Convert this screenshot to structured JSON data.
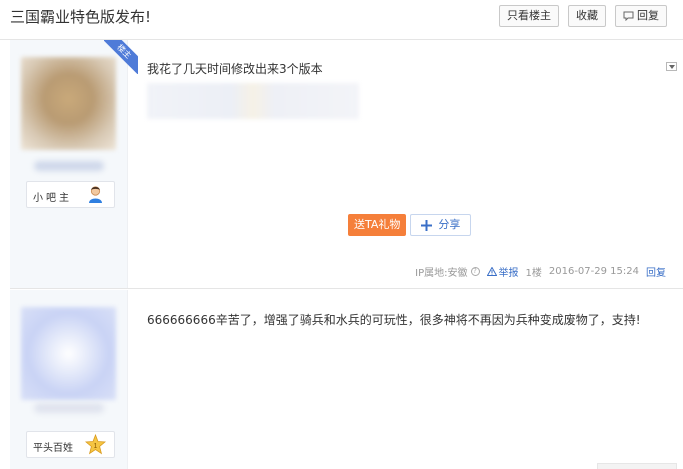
{
  "thread": {
    "title": "三国霸业特色版发布!",
    "buttons": {
      "only_op": "只看楼主",
      "favorite": "收藏",
      "reply": "回复"
    }
  },
  "posts": [
    {
      "corner_tag": "楼主",
      "author_badge": "小吧主",
      "badge_icon": "user-icon",
      "text": "我花了几天时间修改出来3个版本",
      "gift_button": "送TA礼物",
      "share_button": "分享",
      "ip_location": "IP属地:安徽",
      "report": "举报",
      "floor": "1楼",
      "datetime": "2016-07-29 15:24",
      "reply": "回复"
    },
    {
      "author_badge": "平头百姓",
      "badge_icon": "level-1-star-icon",
      "text": "666666666辛苦了，增强了骑兵和水兵的可玩性，很多神将不再因为兵种变成废物了，支持!"
    }
  ],
  "colors": {
    "accent_blue": "#3a6fc7",
    "gift_orange": "#f57f3a",
    "corner_blue": "#4f7bd8",
    "author_bg": "#f5f8fb"
  }
}
